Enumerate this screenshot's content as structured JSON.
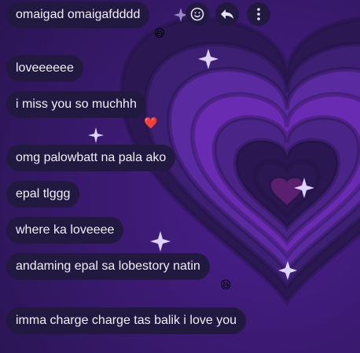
{
  "messages": [
    {
      "text": "omaigad omaigafdddd",
      "reaction": "😆"
    },
    {
      "text": "loveeeeee",
      "reaction": ""
    },
    {
      "text": "i miss you so muchhh",
      "reaction": "❤️"
    },
    {
      "text": "omg palowbatt na pala ako",
      "reaction": ""
    },
    {
      "text": "epal tlggg",
      "reaction": ""
    },
    {
      "text": "where ka loveeee",
      "reaction": ""
    },
    {
      "text": "andaming epal sa lobestory natin",
      "reaction": "😆"
    },
    {
      "text": "imma charge charge tas balik i love you",
      "reaction": ""
    }
  ],
  "actions": {
    "react_icon": "smiley-icon",
    "reply_icon": "reply-arrow-icon",
    "more_icon": "vertical-ellipsis-icon"
  },
  "theme": {
    "bubble": "#21193f",
    "text": "#f2eefb",
    "heart_colors": [
      "#2b1752",
      "#3d1f74",
      "#5a2aa1",
      "#6a2bb3",
      "#4a2487",
      "#2a1650"
    ]
  }
}
